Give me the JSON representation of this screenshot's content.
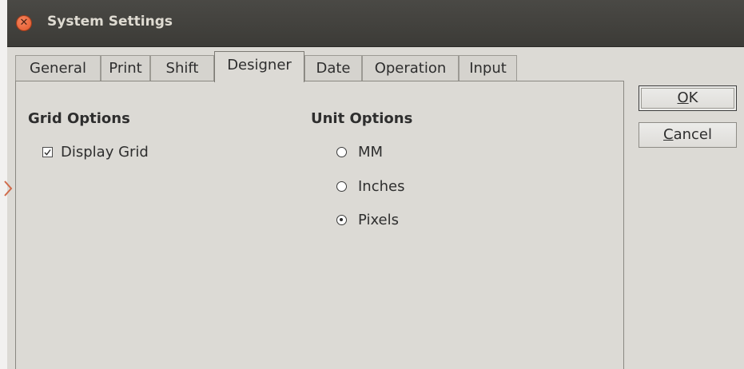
{
  "window": {
    "title": "System Settings"
  },
  "tabs": [
    {
      "label": "General",
      "active": false
    },
    {
      "label": "Print",
      "active": false
    },
    {
      "label": "Shift",
      "active": false
    },
    {
      "label": "Designer",
      "active": true
    },
    {
      "label": "Date",
      "active": false
    },
    {
      "label": "Operation",
      "active": false
    },
    {
      "label": "Input",
      "active": false
    }
  ],
  "grid_options": {
    "title": "Grid Options",
    "display_grid": {
      "label": "Display Grid",
      "checked": true
    }
  },
  "unit_options": {
    "title": "Unit Options",
    "options": [
      {
        "label": "MM",
        "selected": false
      },
      {
        "label": "Inches",
        "selected": false
      },
      {
        "label": "Pixels",
        "selected": true
      }
    ]
  },
  "buttons": {
    "ok": {
      "mnemonic": "O",
      "rest": "K"
    },
    "cancel": {
      "mnemonic": "C",
      "rest": "ancel"
    }
  },
  "colors": {
    "close_button": "#e3572a",
    "titlebar": "#3c3b37",
    "dialog_bg": "#dcdad5",
    "side_marker": "#d06a4a"
  },
  "icons": {
    "close": "close-icon",
    "checkbox": "checkmark-icon",
    "side_marker": "chevron-right-icon"
  }
}
